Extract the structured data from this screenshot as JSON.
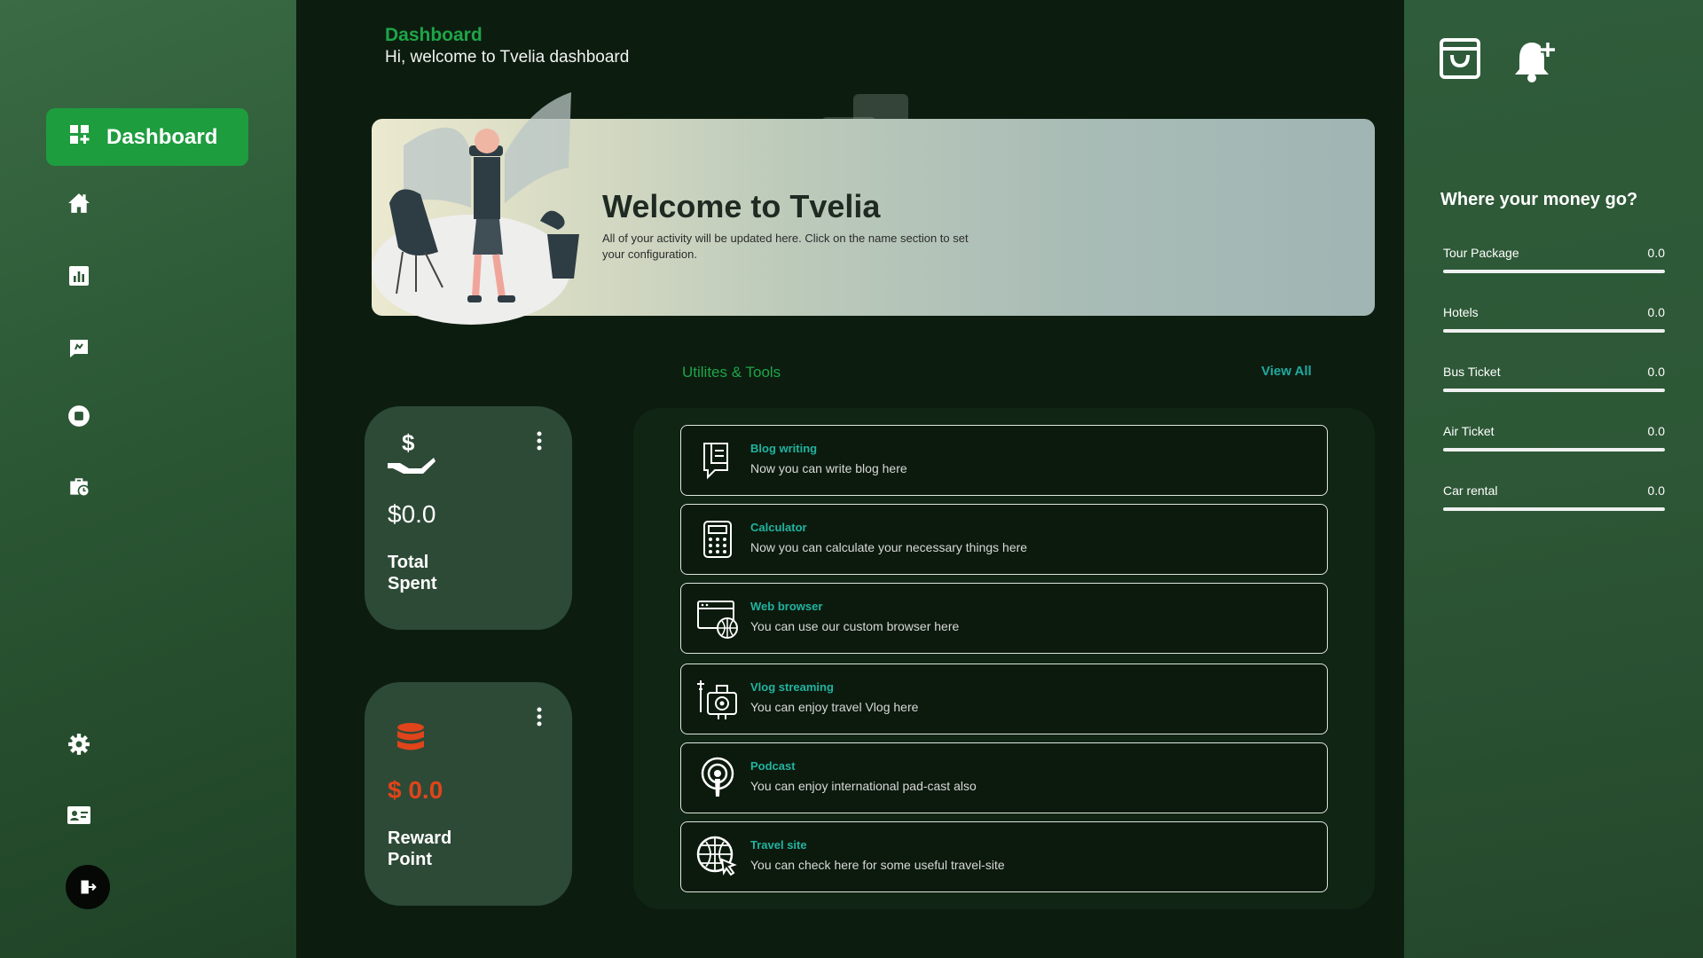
{
  "sidebar": {
    "active_item": {
      "label": "Dashboard",
      "icon": "dashboard-icon"
    },
    "items": [
      {
        "icon": "home-icon"
      },
      {
        "icon": "analytics-icon"
      },
      {
        "icon": "review-icon"
      },
      {
        "icon": "stop-circle-icon"
      },
      {
        "icon": "briefcase-clock-icon"
      }
    ],
    "bottom_items": [
      {
        "icon": "gear-icon"
      },
      {
        "icon": "contact-card-icon"
      },
      {
        "icon": "logout-icon"
      }
    ]
  },
  "header": {
    "title": "Dashboard",
    "subtitle": "Hi, welcome to Tvelia dashboard"
  },
  "hero": {
    "title": "Welcome to Tvelia",
    "description": "All of your activity will be updated here. Click on the name section to set your configuration."
  },
  "cards": {
    "total_spent": {
      "amount": "$0.0",
      "label": "Total Spent",
      "icon": "dollar-hand-icon"
    },
    "reward_point": {
      "amount": "$ 0.0",
      "label": "Reward Point",
      "icon": "database-icon",
      "accent": "#e0441a"
    }
  },
  "tools": {
    "title": "Utilites & Tools",
    "view_all": "View All",
    "items": [
      {
        "name": "Blog writing",
        "desc": "Now you can write blog here",
        "icon": "blog-icon"
      },
      {
        "name": "Calculator",
        "desc": "Now you can calculate your necessary things here",
        "icon": "calculator-icon"
      },
      {
        "name": "Web browser",
        "desc": "You can use our custom browser here",
        "icon": "web-browser-icon"
      },
      {
        "name": "Vlog streaming",
        "desc": "You can enjoy travel Vlog  here",
        "icon": "camera-icon"
      },
      {
        "name": "Podcast",
        "desc": "You can enjoy international pad-cast also",
        "icon": "podcast-icon"
      },
      {
        "name": "Travel site",
        "desc": "You can check here for some useful travel-site",
        "icon": "globe-cursor-icon"
      }
    ]
  },
  "money": {
    "title": "Where your money go?",
    "items": [
      {
        "label": "Tour Package",
        "value": "0.0",
        "fraction": 0
      },
      {
        "label": "Hotels",
        "value": "0.0",
        "fraction": 0
      },
      {
        "label": "Bus Ticket",
        "value": "0.0",
        "fraction": 0
      },
      {
        "label": "Air Ticket",
        "value": "0.0",
        "fraction": 0
      },
      {
        "label": "Car rental",
        "value": "0.0",
        "fraction": 0
      }
    ]
  },
  "topbar": {
    "icons": [
      "shopping-bag-icon",
      "bell-plus-icon"
    ]
  },
  "colors": {
    "accent": "#1e9d3f",
    "tool_title": "#21b3a0",
    "reward": "#e0441a"
  }
}
